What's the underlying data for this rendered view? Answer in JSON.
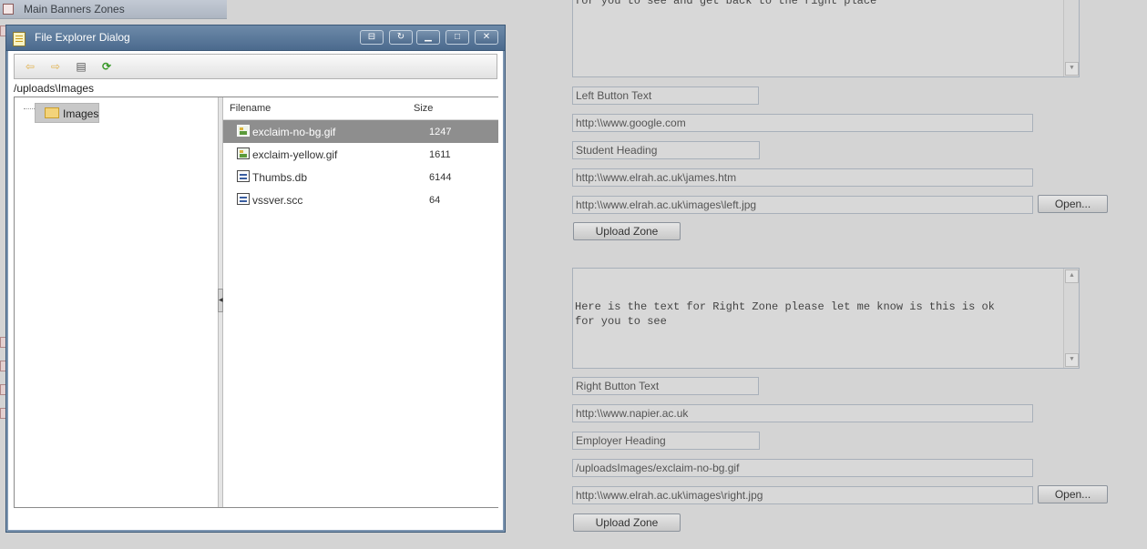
{
  "sidebar": {
    "item_label": "Main Banners Zones"
  },
  "dialog": {
    "title": "File Explorer Dialog",
    "title_buttons": {
      "pin": "pin-icon",
      "reload": "reload-icon",
      "minimize": "minimize-icon",
      "maximize": "maximize-icon",
      "close": "close-icon"
    },
    "toolbar": {
      "back": "arrow-left-icon",
      "forward": "arrow-right-icon",
      "new_file": "new-document-icon",
      "refresh": "refresh-icon"
    },
    "path": "/uploads\\Images",
    "tree": {
      "node_label": "Images"
    },
    "grid": {
      "columns": [
        "Filename",
        "Size"
      ],
      "rows": [
        {
          "name": "exclaim-no-bg.gif",
          "size": "1247",
          "icon": "image",
          "selected": true
        },
        {
          "name": "exclaim-yellow.gif",
          "size": "1611",
          "icon": "image",
          "selected": false
        },
        {
          "name": "Thumbs.db",
          "size": "6144",
          "icon": "db",
          "selected": false
        },
        {
          "name": "vssver.scc",
          "size": "64",
          "icon": "db",
          "selected": false
        }
      ]
    }
  },
  "left_zone": {
    "text": "for you to see and get back to the right place",
    "button_text": "Left Button Text",
    "button_url": "http:\\\\www.google.com",
    "heading": "Student Heading",
    "heading_url": "http:\\\\www.elrah.ac.uk\\james.htm",
    "image_url": "http:\\\\www.elrah.ac.uk\\images\\left.jpg",
    "open_label": "Open...",
    "upload_label": "Upload Zone"
  },
  "right_zone": {
    "text": "Here is the text for Right Zone please let me know is this is ok\nfor you to see",
    "button_text": "Right Button Text",
    "button_url": "http:\\\\www.napier.ac.uk",
    "heading": "Employer Heading",
    "heading_url": "/uploadsImages/exclaim-no-bg.gif",
    "image_url": "http:\\\\www.elrah.ac.uk\\images\\right.jpg",
    "open_label": "Open...",
    "upload_label": "Upload Zone"
  },
  "colors": {
    "titlebar": "#4b6a8d",
    "selected_row": "#8e8e8e",
    "page_background": "#d4d4d4"
  }
}
